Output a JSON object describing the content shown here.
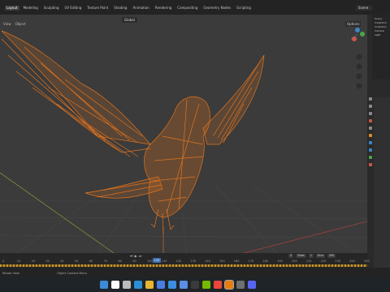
{
  "workspace_tabs": [
    "Layout",
    "Modeling",
    "Sculpting",
    "UV Editing",
    "Texture Paint",
    "Shading",
    "Animation",
    "Rendering",
    "Compositing",
    "Geometry Nodes",
    "Scripting"
  ],
  "scene_name": "Scene",
  "viewport": {
    "orientation": "Global",
    "menu": [
      "View",
      "Object"
    ],
    "options_label": "Options"
  },
  "outliner": {
    "items": [
      "Scene Collection",
      "Collection",
      "Camera",
      "Light"
    ]
  },
  "timeline": {
    "ticks": [
      "0",
      "10",
      "20",
      "30",
      "40",
      "50",
      "60",
      "70",
      "80",
      "90",
      "100",
      "110",
      "120",
      "130",
      "140",
      "150",
      "160",
      "170",
      "180",
      "190",
      "200",
      "210",
      "220",
      "230",
      "240",
      "250"
    ],
    "current_frame": "120",
    "start_label": "Start",
    "start_value": "1",
    "end_label": "End",
    "end_value": "250",
    "frame_field": "0"
  },
  "status": {
    "left": "Rotate View",
    "middle": "Object Context Menu"
  },
  "taskbar": {
    "icons": [
      "windows-icon",
      "search-icon",
      "taskview-icon",
      "edge-icon",
      "explorer-icon",
      "store-icon",
      "mail-icon",
      "photos-icon",
      "terminal-icon",
      "nvidia-icon",
      "chrome-icon",
      "blender-icon",
      "app-icon",
      "discord-icon"
    ]
  },
  "colors": {
    "wire": "#e0731e",
    "viewport_bg": "#3b3b3b",
    "accent": "#3b6fb0"
  }
}
